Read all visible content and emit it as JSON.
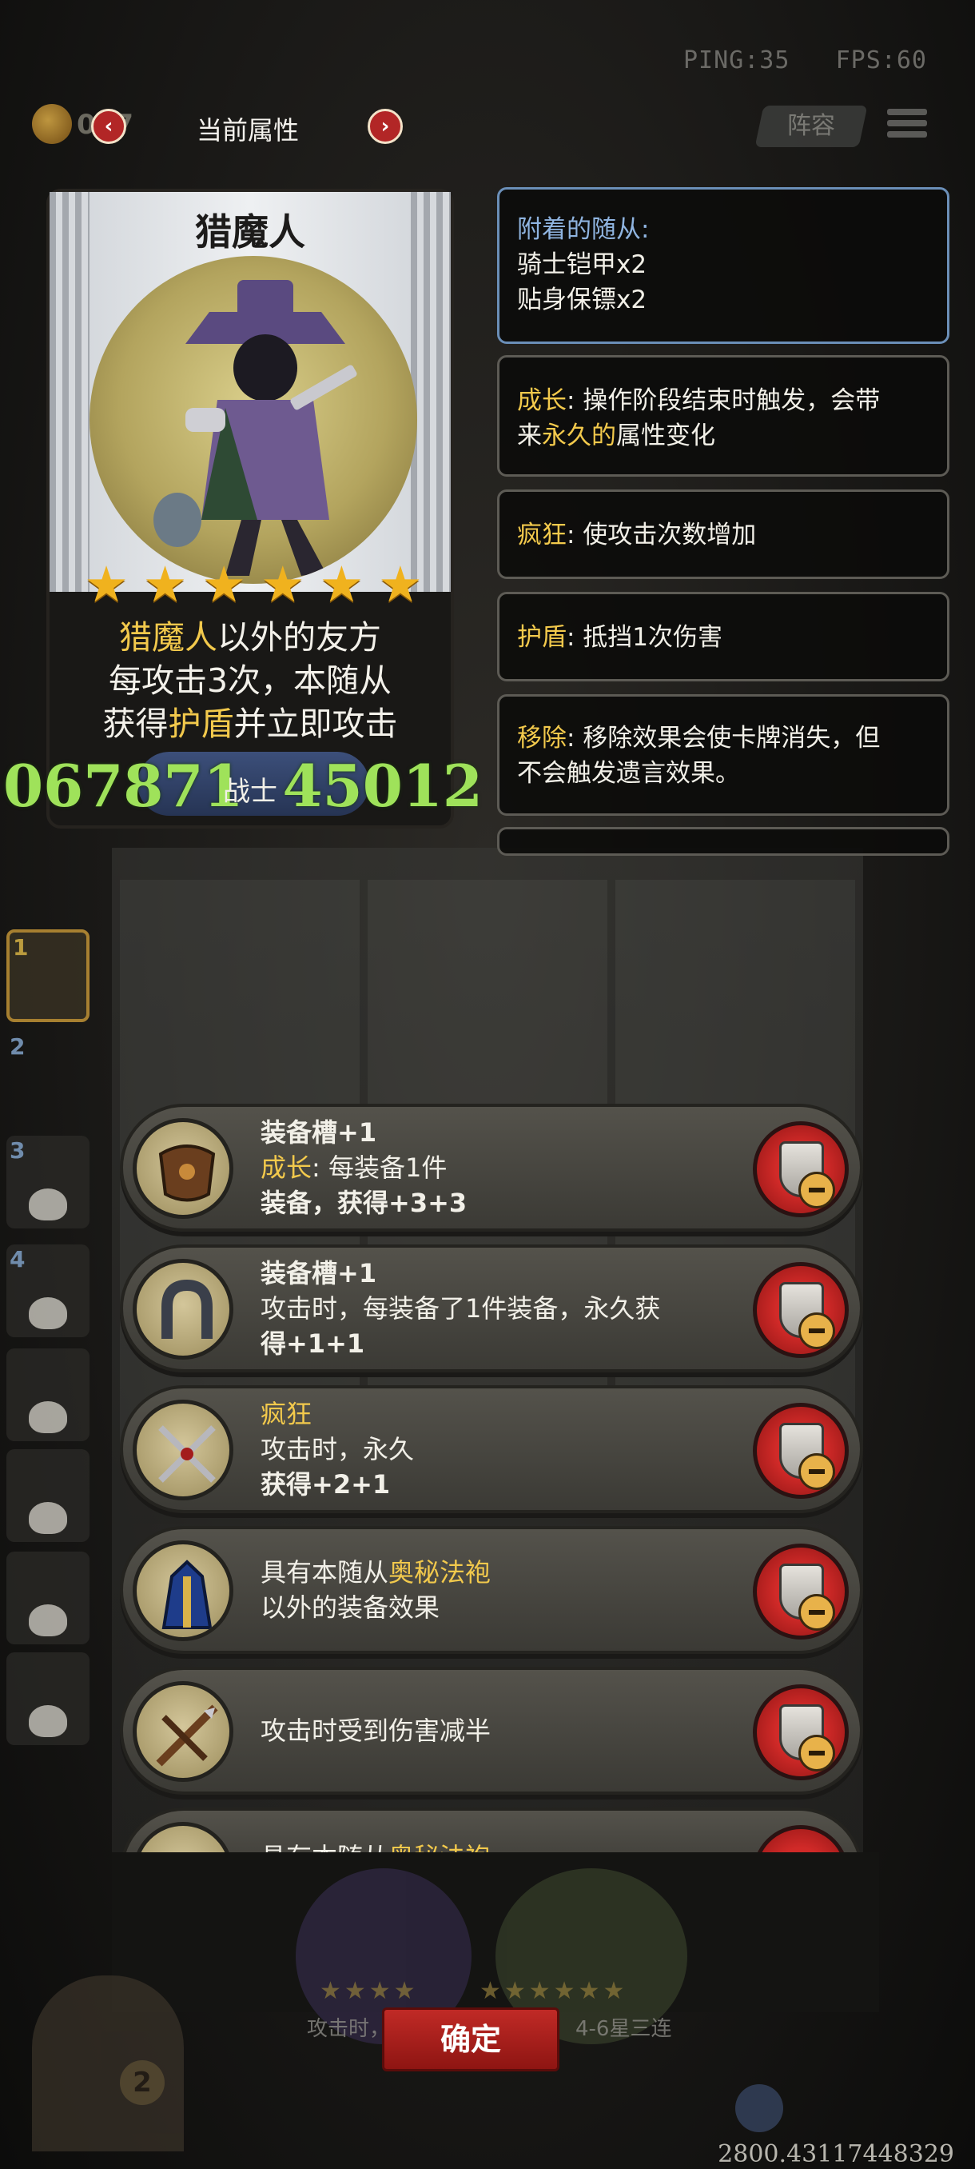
{
  "hud": {
    "ping": "PING:35",
    "fps": "FPS:60",
    "coin_value": "017",
    "title": "当前属性",
    "lineup": "阵容"
  },
  "card": {
    "name": "猎魔人",
    "stars": [
      "★",
      "★",
      "★",
      "★",
      "★",
      "★"
    ],
    "desc": {
      "l1_hl": "猎魔人",
      "l1": "以外的友方",
      "l2": "每攻击3次，本随从",
      "l3a": "获得",
      "l3_hl": "护盾",
      "l3b": "并立即攻击"
    },
    "attack": "067871",
    "class": "战士",
    "health": "45012"
  },
  "info": {
    "attached_title": "附着的随从:",
    "attached_1": "骑士铠甲x2",
    "attached_2": "贴身保镖x2",
    "growth_key": "成长",
    "growth_a": ": 操作阶段结束时触发，会带",
    "growth_b": "来",
    "growth_hl": "永久的",
    "growth_c": "属性变化",
    "frenzy_key": "疯狂",
    "frenzy_text": ": 使攻击次数增加",
    "shield_key": "护盾",
    "shield_text": ": 抵挡1次伤害",
    "remove_key": "移除",
    "remove_a": ": 移除效果会使卡牌消失，但",
    "remove_b": "不会触发遗言效果。"
  },
  "slots": [
    "1",
    "2",
    "3",
    "4"
  ],
  "equipment": [
    {
      "l1": "装备槽+1",
      "l2_key": "成长",
      "l2": ": 每装备1件",
      "l3": "装备，获得+3+3"
    },
    {
      "l1": "装备槽+1",
      "l2": "攻击时，每装备了1件装备，永久获",
      "l3": "得+1+1"
    },
    {
      "l1_key": "疯狂",
      "l2": "攻击时，永久",
      "l3": "获得+2+1"
    },
    {
      "l1": "具有本随从",
      "l1_hl": "奥秘法袍",
      "l2": "以外的装备效果"
    },
    {
      "l1": "攻击时受到伤害减半"
    },
    {
      "l1": "具有本随从",
      "l1_hl": "奥秘法袍"
    }
  ],
  "bottom": {
    "confirm": "确定",
    "door_num": "2",
    "left_faded": "攻击时，术，每",
    "right_faded": "4-6星三连",
    "coords": "2800.43117448329"
  },
  "colors": {
    "highlight": "#f2c94c",
    "accent_red": "#b22626",
    "stat_green": "#9fe25a"
  }
}
